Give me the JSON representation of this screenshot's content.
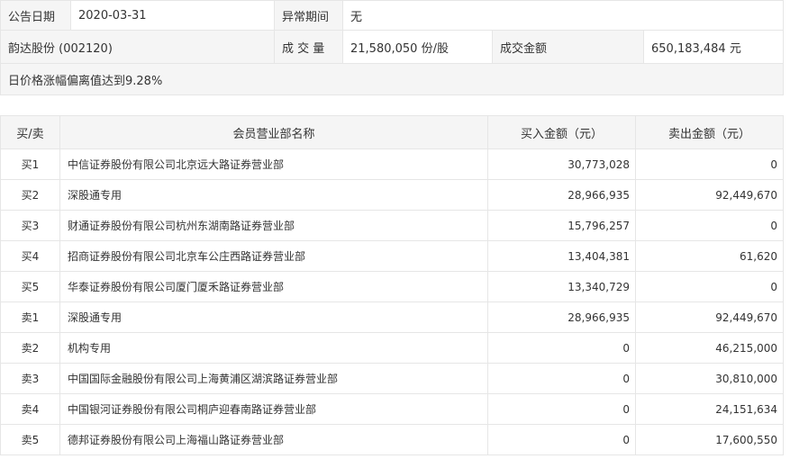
{
  "info": {
    "date_label": "公告日期",
    "date_value": "2020-03-31",
    "abnormal_label": "异常期间",
    "abnormal_value": "无",
    "stock_name": "韵达股份 (002120)",
    "volume_label": "成 交 量",
    "volume_value": "21,580,050 份/股",
    "amount_label": "成交金额",
    "amount_value": "650,183,484 元",
    "reason": "日价格涨幅偏离值达到9.28%"
  },
  "trades": {
    "headers": [
      "买/卖",
      "会员营业部名称",
      "买入金额（元）",
      "卖出金额（元）"
    ],
    "rows": [
      {
        "side": "买1",
        "name": "中信证券股份有限公司北京远大路证券营业部",
        "buy": "30,773,028",
        "sell": "0"
      },
      {
        "side": "买2",
        "name": "深股通专用",
        "buy": "28,966,935",
        "sell": "92,449,670"
      },
      {
        "side": "买3",
        "name": "财通证券股份有限公司杭州东湖南路证券营业部",
        "buy": "15,796,257",
        "sell": "0"
      },
      {
        "side": "买4",
        "name": "招商证券股份有限公司北京车公庄西路证券营业部",
        "buy": "13,404,381",
        "sell": "61,620"
      },
      {
        "side": "买5",
        "name": "华泰证券股份有限公司厦门厦禾路证券营业部",
        "buy": "13,340,729",
        "sell": "0"
      },
      {
        "side": "卖1",
        "name": "深股通专用",
        "buy": "28,966,935",
        "sell": "92,449,670"
      },
      {
        "side": "卖2",
        "name": "机构专用",
        "buy": "0",
        "sell": "46,215,000"
      },
      {
        "side": "卖3",
        "name": "中国国际金融股份有限公司上海黄浦区湖滨路证券营业部",
        "buy": "0",
        "sell": "30,810,000"
      },
      {
        "side": "卖4",
        "name": "中国银河证券股份有限公司桐庐迎春南路证券营业部",
        "buy": "0",
        "sell": "24,151,634"
      },
      {
        "side": "卖5",
        "name": "德邦证券股份有限公司上海福山路证券营业部",
        "buy": "0",
        "sell": "17,600,550"
      }
    ]
  }
}
